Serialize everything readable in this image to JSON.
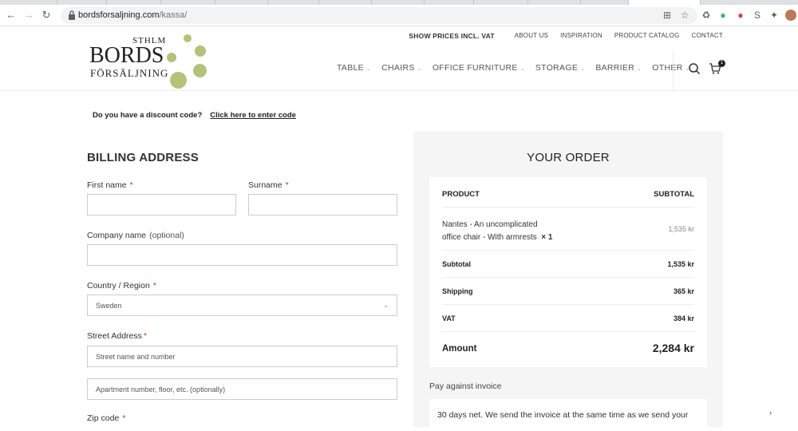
{
  "browser": {
    "url_domain": "bordsforsaljning.com",
    "url_path": "/kassa/"
  },
  "logo": {
    "line1": "STHLM",
    "line2": "BORDS",
    "line3": "FÖRSÄLJNING"
  },
  "top_links": {
    "prices": "SHOW PRICES INCL. VAT",
    "about": "ABOUT US",
    "inspiration": "INSPIRATION",
    "catalog": "PRODUCT CATALOG",
    "contact": "CONTACT"
  },
  "main_nav": [
    {
      "label": "TABLE"
    },
    {
      "label": "CHAIRS"
    },
    {
      "label": "OFFICE FURNITURE"
    },
    {
      "label": "STORAGE"
    },
    {
      "label": "BARRIER"
    },
    {
      "label": "OTHER"
    }
  ],
  "cart": {
    "count": "1"
  },
  "discount": {
    "question": "Do you have a discount code?",
    "link": "Click here to enter code"
  },
  "billing": {
    "title": "BILLING ADDRESS",
    "first_name_label": "First name",
    "surname_label": "Surname",
    "company_label": "Company name",
    "optional": "(optional)",
    "country_label": "Country / Region",
    "country_value": "Sweden",
    "street_label": "Street Address",
    "street_placeholder": "Street name and number",
    "apt_placeholder": "Apartment number, floor, etc.  (optionally)",
    "zip_label": "Zip code",
    "required_mark": "*"
  },
  "order": {
    "title": "YOUR ORDER",
    "col_product": "PRODUCT",
    "col_subtotal": "SUBTOTAL",
    "item_line1": "Nantes - An uncomplicated",
    "item_line2": "office chair - With armrests",
    "item_qty": "× 1",
    "item_price": "1,535  kr",
    "subtotal_label": "Subtotal",
    "subtotal_value": "1,535  kr",
    "shipping_label": "Shipping",
    "shipping_value": "365  kr",
    "vat_label": "VAT",
    "vat_value": "384  kr",
    "amount_label": "Amount",
    "amount_value": "2,284  kr"
  },
  "payment": {
    "method": "Pay against invoice",
    "description": "30 days net. We send the invoice at the same time as we send your"
  },
  "colors": {
    "logo_green": "#b5c27a",
    "required_red": "#c0392b",
    "panel_grey": "#f5f5f5"
  }
}
